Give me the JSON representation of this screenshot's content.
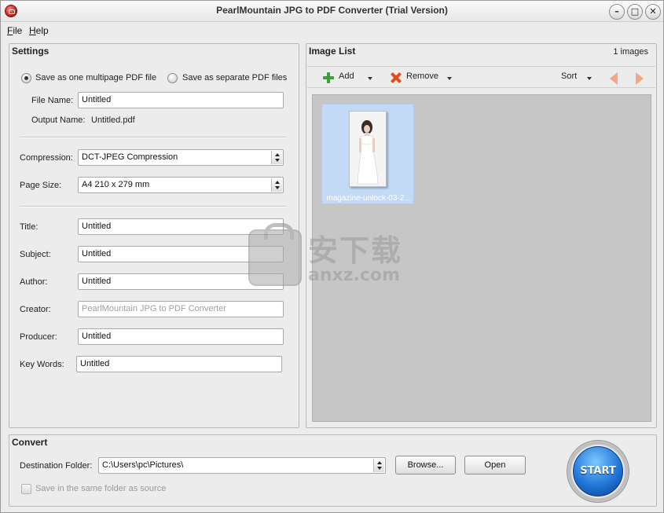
{
  "window": {
    "title": "PearlMountain JPG to PDF Converter (Trial Version)",
    "controls": {
      "minimize": "–",
      "maximize": "□",
      "close": "✕"
    }
  },
  "menu": {
    "file": "File",
    "file_u": "F",
    "file_rest": "ile",
    "help_u": "H",
    "help_rest": "elp"
  },
  "settings": {
    "title": "Settings",
    "radio_multi": "Save as one multipage PDF file",
    "radio_separate": "Save as separate PDF files",
    "selected_mode": "multi",
    "file_name_label": "File Name:",
    "file_name": "Untitled",
    "output_name_label": "Output Name:",
    "output_name": "Untitled.pdf",
    "compression_label": "Compression:",
    "compression": "DCT-JPEG Compression",
    "page_size_label": "Page Size:",
    "page_size": "A4 210 x 279 mm",
    "title_label": "Title:",
    "title_value": "Untitled",
    "subject_label": "Subject:",
    "subject_value": "Untitled",
    "author_label": "Author:",
    "author_value": "Untitled",
    "creator_label": "Creator:",
    "creator_value": "PearlMountain JPG to PDF Converter",
    "producer_label": "Producer:",
    "producer_value": "Untitled",
    "keywords_label": "Key Words:",
    "keywords_value": "Untitled"
  },
  "image_list": {
    "title": "Image List",
    "count": "1 images",
    "add_label": "Add",
    "remove_label": "Remove",
    "sort_label": "Sort",
    "items": [
      {
        "caption": "magazine-unlock-03-2..."
      }
    ]
  },
  "convert": {
    "title": "Convert",
    "destination_label": "Destination Folder:",
    "destination": "C:\\Users\\pc\\Pictures\\",
    "browse_label": "Browse...",
    "open_label": "Open",
    "same_folder_label": "Save in the same folder as source",
    "same_folder_checked": false,
    "start_label": "START"
  },
  "watermark": {
    "text_cn": "安下载",
    "text_en": "anxz.com"
  },
  "colors": {
    "accent_blue": "#2176d8",
    "selection": "#c3daf6",
    "gallery_bg": "#c6c6c6"
  }
}
